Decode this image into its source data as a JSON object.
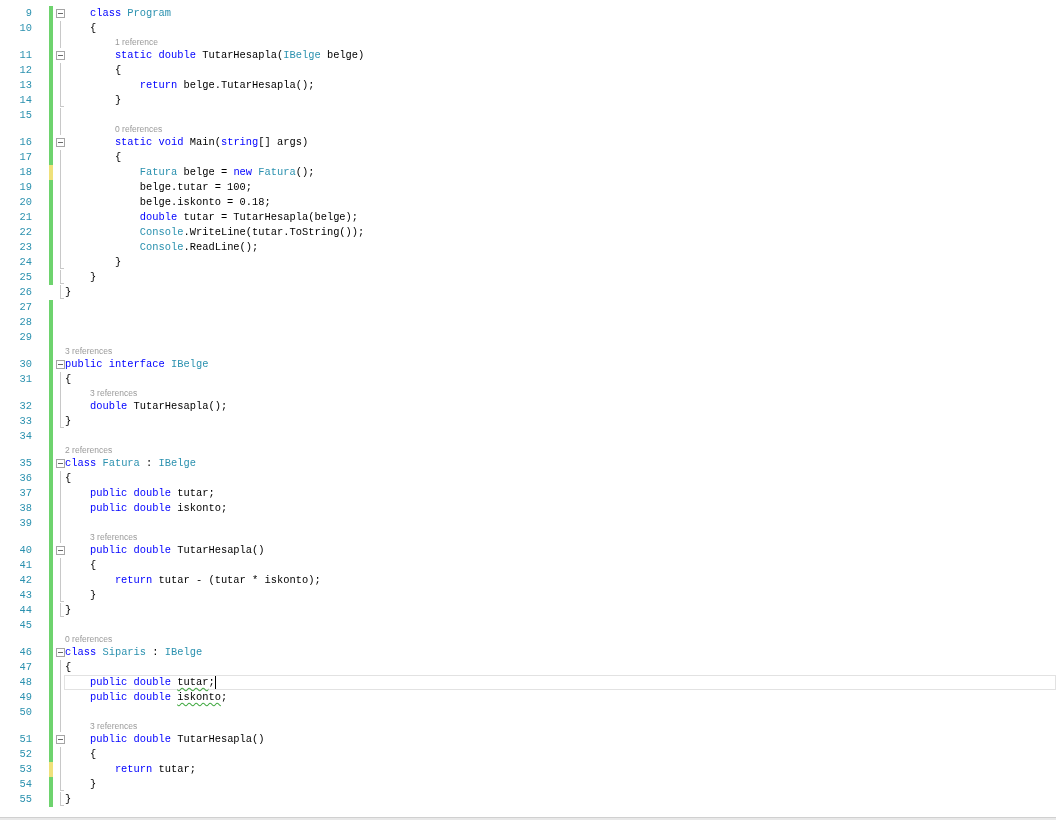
{
  "editor": {
    "lines": [
      {
        "number": "9",
        "tracked": true,
        "changed": false,
        "collapsible": true,
        "in_block": false,
        "block_end": false,
        "current": false,
        "tokens": [
          {
            "text": "    class ",
            "kind": "keyword"
          },
          {
            "text": "Program",
            "kind": "type"
          }
        ]
      },
      {
        "number": "10",
        "tracked": true,
        "changed": false,
        "collapsible": false,
        "in_block": true,
        "block_end": false,
        "current": false,
        "tokens": [
          {
            "text": "    {",
            "kind": "plain"
          }
        ]
      },
      {
        "number": "11",
        "tracked": true,
        "changed": false,
        "collapsible": true,
        "in_block": false,
        "block_end": false,
        "current": false,
        "lens": "1 reference",
        "tokens": [
          {
            "text": "        static double ",
            "kind": "keyword"
          },
          {
            "text": "TutarHesapla(",
            "kind": "plain"
          },
          {
            "text": "IBelge",
            "kind": "type"
          },
          {
            "text": " belge)",
            "kind": "plain"
          }
        ]
      },
      {
        "number": "12",
        "tracked": true,
        "changed": false,
        "collapsible": false,
        "in_block": true,
        "block_end": false,
        "current": false,
        "tokens": [
          {
            "text": "        {",
            "kind": "plain"
          }
        ]
      },
      {
        "number": "13",
        "tracked": true,
        "changed": false,
        "collapsible": false,
        "in_block": true,
        "block_end": false,
        "current": false,
        "tokens": [
          {
            "text": "            return ",
            "kind": "keyword"
          },
          {
            "text": "belge.TutarHesapla();",
            "kind": "plain"
          }
        ]
      },
      {
        "number": "14",
        "tracked": true,
        "changed": false,
        "collapsible": false,
        "in_block": false,
        "block_end": true,
        "current": false,
        "tokens": [
          {
            "text": "        }",
            "kind": "plain"
          }
        ]
      },
      {
        "number": "15",
        "tracked": true,
        "changed": false,
        "collapsible": false,
        "in_block": true,
        "block_end": false,
        "current": false
      },
      {
        "number": "16",
        "tracked": true,
        "changed": false,
        "collapsible": true,
        "in_block": false,
        "block_end": false,
        "current": false,
        "lens": "0 references",
        "tokens": [
          {
            "text": "        static void ",
            "kind": "keyword"
          },
          {
            "text": "Main(",
            "kind": "plain"
          },
          {
            "text": "string",
            "kind": "keyword"
          },
          {
            "text": "[] args)",
            "kind": "plain"
          }
        ]
      },
      {
        "number": "17",
        "tracked": true,
        "changed": false,
        "collapsible": false,
        "in_block": true,
        "block_end": false,
        "current": false,
        "tokens": [
          {
            "text": "        {",
            "kind": "plain"
          }
        ]
      },
      {
        "number": "18",
        "tracked": true,
        "changed": true,
        "collapsible": false,
        "in_block": true,
        "block_end": false,
        "current": false,
        "tokens": [
          {
            "text": "            Fatura",
            "kind": "type"
          },
          {
            "text": " belge = ",
            "kind": "plain"
          },
          {
            "text": "new ",
            "kind": "keyword"
          },
          {
            "text": "Fatura",
            "kind": "type"
          },
          {
            "text": "();",
            "kind": "plain"
          }
        ]
      },
      {
        "number": "19",
        "tracked": true,
        "changed": false,
        "collapsible": false,
        "in_block": true,
        "block_end": false,
        "current": false,
        "tokens": [
          {
            "text": "            belge.tutar = 100;",
            "kind": "plain"
          }
        ]
      },
      {
        "number": "20",
        "tracked": true,
        "changed": false,
        "collapsible": false,
        "in_block": true,
        "block_end": false,
        "current": false,
        "tokens": [
          {
            "text": "            belge.iskonto = 0.18;",
            "kind": "plain"
          }
        ]
      },
      {
        "number": "21",
        "tracked": true,
        "changed": false,
        "collapsible": false,
        "in_block": true,
        "block_end": false,
        "current": false,
        "tokens": [
          {
            "text": "            double ",
            "kind": "keyword"
          },
          {
            "text": "tutar = TutarHesapla(belge);",
            "kind": "plain"
          }
        ]
      },
      {
        "number": "22",
        "tracked": true,
        "changed": false,
        "collapsible": false,
        "in_block": true,
        "block_end": false,
        "current": false,
        "tokens": [
          {
            "text": "            Console",
            "kind": "type"
          },
          {
            "text": ".WriteLine(tutar.ToString());",
            "kind": "plain"
          }
        ]
      },
      {
        "number": "23",
        "tracked": true,
        "changed": false,
        "collapsible": false,
        "in_block": true,
        "block_end": false,
        "current": false,
        "tokens": [
          {
            "text": "            Console",
            "kind": "type"
          },
          {
            "text": ".ReadLine();",
            "kind": "plain"
          }
        ]
      },
      {
        "number": "24",
        "tracked": true,
        "changed": false,
        "collapsible": false,
        "in_block": false,
        "block_end": true,
        "current": false,
        "tokens": [
          {
            "text": "        }",
            "kind": "plain"
          }
        ]
      },
      {
        "number": "25",
        "tracked": true,
        "changed": false,
        "collapsible": false,
        "in_block": false,
        "block_end": true,
        "current": false,
        "tokens": [
          {
            "text": "    }",
            "kind": "plain"
          }
        ]
      },
      {
        "number": "26",
        "tracked": false,
        "changed": false,
        "collapsible": false,
        "in_block": false,
        "block_end": true,
        "current": false,
        "tokens": [
          {
            "text": "}",
            "kind": "plain"
          }
        ]
      },
      {
        "number": "27",
        "tracked": true,
        "changed": false,
        "collapsible": false,
        "in_block": false,
        "block_end": false,
        "current": false
      },
      {
        "number": "28",
        "tracked": true,
        "changed": false,
        "collapsible": false,
        "in_block": false,
        "block_end": false,
        "current": false
      },
      {
        "number": "29",
        "tracked": true,
        "changed": false,
        "collapsible": false,
        "in_block": false,
        "block_end": false,
        "current": false
      },
      {
        "number": "30",
        "tracked": true,
        "changed": false,
        "collapsible": true,
        "in_block": false,
        "block_end": false,
        "current": false,
        "lens": "3 references",
        "tokens": [
          {
            "text": "public interface ",
            "kind": "keyword"
          },
          {
            "text": "IBelge",
            "kind": "type"
          }
        ]
      },
      {
        "number": "31",
        "tracked": true,
        "changed": false,
        "collapsible": false,
        "in_block": true,
        "block_end": false,
        "current": false,
        "tokens": [
          {
            "text": "{",
            "kind": "plain"
          }
        ]
      },
      {
        "number": "32",
        "tracked": true,
        "changed": false,
        "collapsible": false,
        "in_block": true,
        "block_end": false,
        "current": false,
        "lens": "3 references",
        "tokens": [
          {
            "text": "    double ",
            "kind": "keyword"
          },
          {
            "text": "TutarHesapla();",
            "kind": "plain"
          }
        ]
      },
      {
        "number": "33",
        "tracked": true,
        "changed": false,
        "collapsible": false,
        "in_block": false,
        "block_end": true,
        "current": false,
        "tokens": [
          {
            "text": "}",
            "kind": "plain"
          }
        ]
      },
      {
        "number": "34",
        "tracked": true,
        "changed": false,
        "collapsible": false,
        "in_block": false,
        "block_end": false,
        "current": false
      },
      {
        "number": "35",
        "tracked": true,
        "changed": false,
        "collapsible": true,
        "in_block": false,
        "block_end": false,
        "current": false,
        "lens": "2 references",
        "tokens": [
          {
            "text": "class ",
            "kind": "keyword"
          },
          {
            "text": "Fatura",
            "kind": "type"
          },
          {
            "text": " : ",
            "kind": "plain"
          },
          {
            "text": "IBelge",
            "kind": "type"
          }
        ]
      },
      {
        "number": "36",
        "tracked": true,
        "changed": false,
        "collapsible": false,
        "in_block": true,
        "block_end": false,
        "current": false,
        "tokens": [
          {
            "text": "{",
            "kind": "plain"
          }
        ]
      },
      {
        "number": "37",
        "tracked": true,
        "changed": false,
        "collapsible": false,
        "in_block": true,
        "block_end": false,
        "current": false,
        "tokens": [
          {
            "text": "    public double ",
            "kind": "keyword"
          },
          {
            "text": "tutar;",
            "kind": "plain"
          }
        ]
      },
      {
        "number": "38",
        "tracked": true,
        "changed": false,
        "collapsible": false,
        "in_block": true,
        "block_end": false,
        "current": false,
        "tokens": [
          {
            "text": "    public double ",
            "kind": "keyword"
          },
          {
            "text": "iskonto;",
            "kind": "plain"
          }
        ]
      },
      {
        "number": "39",
        "tracked": true,
        "changed": false,
        "collapsible": false,
        "in_block": true,
        "block_end": false,
        "current": false
      },
      {
        "number": "40",
        "tracked": true,
        "changed": false,
        "collapsible": true,
        "in_block": false,
        "block_end": false,
        "current": false,
        "lens": "3 references",
        "tokens": [
          {
            "text": "    public double ",
            "kind": "keyword"
          },
          {
            "text": "TutarHesapla()",
            "kind": "plain"
          }
        ]
      },
      {
        "number": "41",
        "tracked": true,
        "changed": false,
        "collapsible": false,
        "in_block": true,
        "block_end": false,
        "current": false,
        "tokens": [
          {
            "text": "    {",
            "kind": "plain"
          }
        ]
      },
      {
        "number": "42",
        "tracked": true,
        "changed": false,
        "collapsible": false,
        "in_block": true,
        "block_end": false,
        "current": false,
        "tokens": [
          {
            "text": "        return ",
            "kind": "keyword"
          },
          {
            "text": "tutar - (tutar * iskonto);",
            "kind": "plain"
          }
        ]
      },
      {
        "number": "43",
        "tracked": true,
        "changed": false,
        "collapsible": false,
        "in_block": false,
        "block_end": true,
        "current": false,
        "tokens": [
          {
            "text": "    }",
            "kind": "plain"
          }
        ]
      },
      {
        "number": "44",
        "tracked": true,
        "changed": false,
        "collapsible": false,
        "in_block": false,
        "block_end": true,
        "current": false,
        "tokens": [
          {
            "text": "}",
            "kind": "plain"
          }
        ]
      },
      {
        "number": "45",
        "tracked": true,
        "changed": false,
        "collapsible": false,
        "in_block": false,
        "block_end": false,
        "current": false
      },
      {
        "number": "46",
        "tracked": true,
        "changed": false,
        "collapsible": true,
        "in_block": false,
        "block_end": false,
        "current": false,
        "lens": "0 references",
        "tokens": [
          {
            "text": "class ",
            "kind": "keyword"
          },
          {
            "text": "Siparis",
            "kind": "type"
          },
          {
            "text": " : ",
            "kind": "plain"
          },
          {
            "text": "IBelge",
            "kind": "type"
          }
        ]
      },
      {
        "number": "47",
        "tracked": true,
        "changed": false,
        "collapsible": false,
        "in_block": true,
        "block_end": false,
        "current": false,
        "tokens": [
          {
            "text": "{",
            "kind": "plain"
          }
        ]
      },
      {
        "number": "48",
        "tracked": true,
        "changed": false,
        "collapsible": false,
        "in_block": true,
        "block_end": false,
        "current": true,
        "tokens": [
          {
            "text": "    public double ",
            "kind": "keyword"
          },
          {
            "text": "tutar",
            "kind": "warning"
          },
          {
            "text": ";",
            "kind": "plain"
          }
        ]
      },
      {
        "number": "49",
        "tracked": true,
        "changed": false,
        "collapsible": false,
        "in_block": true,
        "block_end": false,
        "current": false,
        "tokens": [
          {
            "text": "    public double ",
            "kind": "keyword"
          },
          {
            "text": "iskonto",
            "kind": "warning"
          },
          {
            "text": ";",
            "kind": "plain"
          }
        ]
      },
      {
        "number": "50",
        "tracked": true,
        "changed": false,
        "collapsible": false,
        "in_block": true,
        "block_end": false,
        "current": false
      },
      {
        "number": "51",
        "tracked": true,
        "changed": false,
        "collapsible": true,
        "in_block": false,
        "block_end": false,
        "current": false,
        "lens": "3 references",
        "tokens": [
          {
            "text": "    public double ",
            "kind": "keyword"
          },
          {
            "text": "TutarHesapla()",
            "kind": "plain"
          }
        ]
      },
      {
        "number": "52",
        "tracked": true,
        "changed": false,
        "collapsible": false,
        "in_block": true,
        "block_end": false,
        "current": false,
        "tokens": [
          {
            "text": "    {",
            "kind": "plain"
          }
        ]
      },
      {
        "number": "53",
        "tracked": true,
        "changed": true,
        "collapsible": false,
        "in_block": true,
        "block_end": false,
        "current": false,
        "tokens": [
          {
            "text": "        return ",
            "kind": "keyword"
          },
          {
            "text": "tutar;",
            "kind": "plain"
          }
        ]
      },
      {
        "number": "54",
        "tracked": true,
        "changed": false,
        "collapsible": false,
        "in_block": false,
        "block_end": true,
        "current": false,
        "tokens": [
          {
            "text": "    }",
            "kind": "plain"
          }
        ]
      },
      {
        "number": "55",
        "tracked": true,
        "changed": false,
        "collapsible": false,
        "in_block": false,
        "block_end": true,
        "current": false,
        "tokens": [
          {
            "text": "}",
            "kind": "plain"
          }
        ]
      }
    ]
  }
}
